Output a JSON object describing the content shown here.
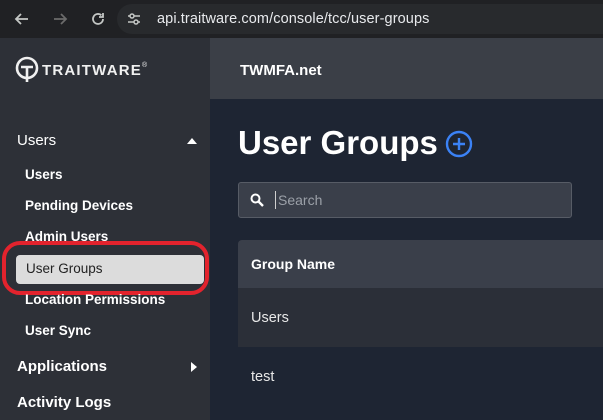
{
  "browser": {
    "url": "api.traitware.com/console/tcc/user-groups"
  },
  "brand": {
    "logo_text": "TRAITWARE",
    "trademark": "®"
  },
  "sidebar": {
    "sections": [
      {
        "label": "Users",
        "expanded": true,
        "items": [
          "Users",
          "Pending Devices",
          "Admin Users",
          "User Groups",
          "Location Permissions",
          "User Sync"
        ]
      },
      {
        "label": "Applications",
        "expanded": false
      },
      {
        "label": "Activity Logs"
      }
    ],
    "active_item": "User Groups"
  },
  "header": {
    "org_name": "TWMFA.net"
  },
  "main": {
    "title": "User Groups",
    "search_placeholder": "Search",
    "table": {
      "column": "Group Name",
      "rows": [
        "Users",
        "test"
      ]
    }
  },
  "colors": {
    "accent": "#3b82f6",
    "highlight": "#e3232d"
  }
}
